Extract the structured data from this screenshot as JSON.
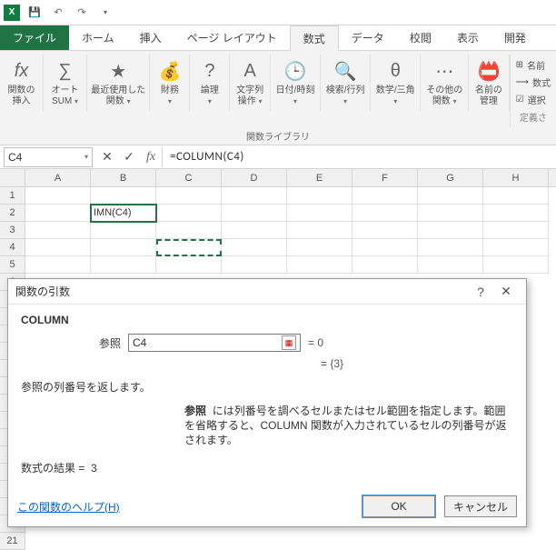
{
  "titlebar": {
    "save_icon": "save",
    "undo_icon": "undo",
    "redo_icon": "redo"
  },
  "tabs": {
    "file": "ファイル",
    "home": "ホーム",
    "insert": "挿入",
    "page_layout": "ページ レイアウト",
    "formulas": "数式",
    "data": "データ",
    "review": "校閲",
    "view": "表示",
    "developer": "開発"
  },
  "ribbon": {
    "insert_fn_top": "関数の",
    "insert_fn_bot": "挿入",
    "autosum_top": "オート",
    "autosum_bot": "SUM",
    "recent_top": "最近使用した",
    "recent_bot": "関数",
    "financial": "財務",
    "logical": "論理",
    "text_top": "文字列",
    "text_bot": "操作",
    "datetime": "日付/時刻",
    "lookup": "検索/行列",
    "mathtrig": "数学/三角",
    "more_top": "その他の",
    "more_bot": "関数",
    "name_top": "名前の",
    "name_bot": "管理",
    "section_label": "関数ライブラリ",
    "def_name": "名前",
    "use_formula": "数式",
    "create_sel": "選択",
    "defined_label": "定義さ"
  },
  "fbar": {
    "namebox": "C4",
    "formula": "=COLUMN(C4)"
  },
  "grid": {
    "cols": [
      "A",
      "B",
      "C",
      "D",
      "E",
      "F",
      "G",
      "H"
    ],
    "b2": "IMN(C4)"
  },
  "dialog": {
    "title": "関数の引数",
    "func": "COLUMN",
    "arg_label": "参照",
    "arg_value": "C4",
    "arg_eval": "=  0",
    "result_eval": "=  {3}",
    "desc": "参照の列番号を返します。",
    "help_lead": "参照",
    "help_text": "には列番号を調べるセルまたはセル範囲を指定します。範囲を省略すると、COLUMN 関数が入力されているセルの列番号が返されます。",
    "result_label": "数式の結果 =",
    "result_value": "3",
    "help_link": "この関数のヘルプ(H)",
    "ok": "OK",
    "cancel": "キャンセル"
  },
  "chart_data": null
}
